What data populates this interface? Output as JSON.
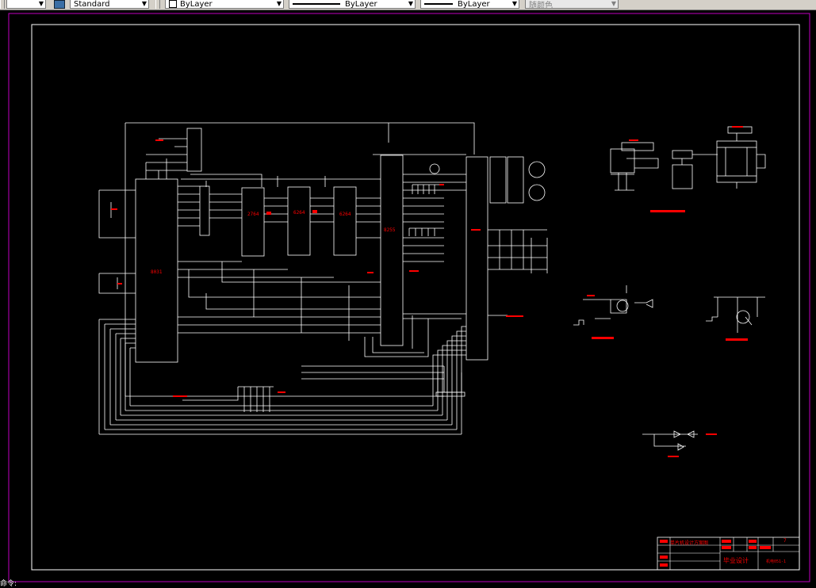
{
  "toolbar": {
    "text_style": "Standard",
    "layer": "ByLayer",
    "linetype": "ByLayer",
    "lineweight": "ByLayer",
    "plot_color": "随颜色"
  },
  "colors": {
    "paper_border": "#c000c0",
    "frame": "#ffffff",
    "wire": "#ffffff",
    "label": "#ff0000"
  },
  "chips": {
    "cpu": "8031",
    "eprom": "2764",
    "ram": "6264",
    "pio": "8255"
  },
  "title_block": {
    "drawing_title": "毕业设计",
    "design_name": "单片机设计方案图",
    "drawing_no": "机电051-1",
    "sheet": "7"
  },
  "command_prompt": "命令:"
}
